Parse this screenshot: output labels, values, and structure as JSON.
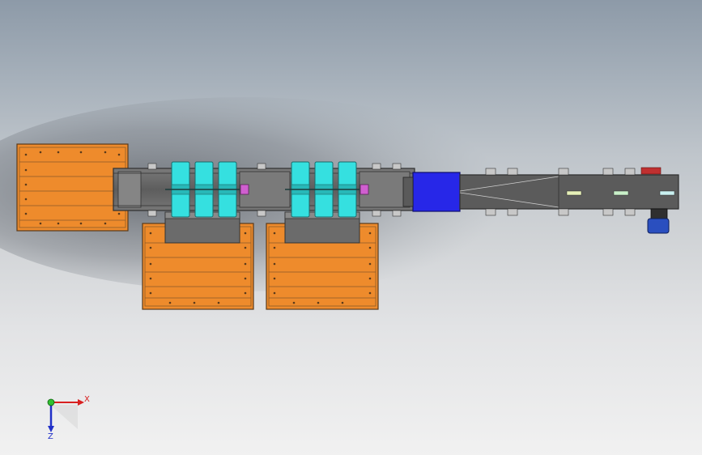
{
  "triad": {
    "x_label": "X",
    "y_label": "Z"
  },
  "colors": {
    "pallet": "#ee8b2c",
    "pallet_dark": "#c86a18",
    "frame": "#6e6e6e",
    "frame_dark": "#3e3e3e",
    "roller": "#35e0e0",
    "motor_block": "#2727e8",
    "gear_motor": "#2a4fbf",
    "tag": "#c03030",
    "marker": "#d05fd0"
  },
  "model": {
    "components": [
      "pallet-left",
      "pallet-lower-1",
      "pallet-lower-2",
      "conveyor-frame",
      "roller-group-1",
      "roller-group-2",
      "drive-block",
      "tapered-tail",
      "gear-motor"
    ]
  }
}
